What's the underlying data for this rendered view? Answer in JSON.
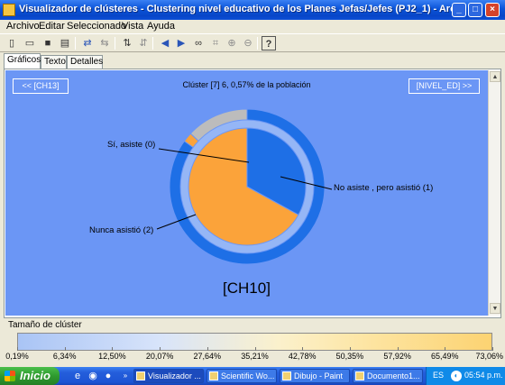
{
  "window": {
    "title": "Visualizador de clústeres - Clustering nivel educativo de los Planes Jefas/Jefes (PJ2_1) - Archivo local: general I...",
    "controls": {
      "minimize": "_",
      "maximize": "□",
      "close": "×"
    }
  },
  "menu": [
    "Archivo",
    "Editar",
    "Seleccionado",
    "Vista",
    "Ayuda"
  ],
  "toolbar": {
    "icons": [
      "new-icon",
      "open-icon",
      "save-icon",
      "print-icon",
      "swap-icon",
      "refresh-icon",
      "sort-icon",
      "filter-icon",
      "prev-icon",
      "next-icon",
      "binoculars-icon",
      "select-icon",
      "zoom-in-icon",
      "zoom-out-icon",
      "help-icon"
    ],
    "help_glyph": "?"
  },
  "tabs": [
    "Gráficos",
    "Texto",
    "Detalles"
  ],
  "chart": {
    "nav_prev": "<< [CH13]",
    "nav_next": "[NIVEL_ED] >>",
    "cluster_title": "Clúster [7] 6, 0,57% de la población",
    "variable_name": "[CH10]",
    "labels": [
      "Sí, asiste (0)",
      "No asiste , pero asistió (1)",
      "Nunca asistió (2)"
    ]
  },
  "chart_data": {
    "type": "pie",
    "title": "Clúster [7] 6, 0,57% de la población",
    "xlabel": "[CH10]",
    "inner_pie": {
      "categories": [
        "Sí, asiste (0)",
        "No asiste , pero asistió (1)",
        "Nunca asistió (2)"
      ],
      "values": [
        0,
        33,
        67
      ],
      "colors": [
        "#1e6fe6",
        "#1e6fe6",
        "#fba33a"
      ]
    },
    "outer_ring": {
      "categories": [
        "No asiste , pero asistió (1)",
        "Nunca asistió (2)",
        "Other"
      ],
      "values": [
        85,
        2,
        13
      ],
      "colors": [
        "#1e6fe6",
        "#fba33a",
        "#bcbcbc"
      ]
    }
  },
  "cluster_size": {
    "label": "Tamaño de clúster",
    "ticks": [
      "0,19%",
      "6,34%",
      "12,50%",
      "20,07%",
      "27,64%",
      "35,21%",
      "42,78%",
      "50,35%",
      "57,92%",
      "65,49%",
      "73,06%"
    ]
  },
  "taskbar": {
    "start": "Inicio",
    "items": [
      "Visualizador ...",
      "Scientific Wo...",
      "Dibujo - Paint",
      "Documento1..."
    ],
    "lang": "ES",
    "time": "05:54 p.m."
  }
}
